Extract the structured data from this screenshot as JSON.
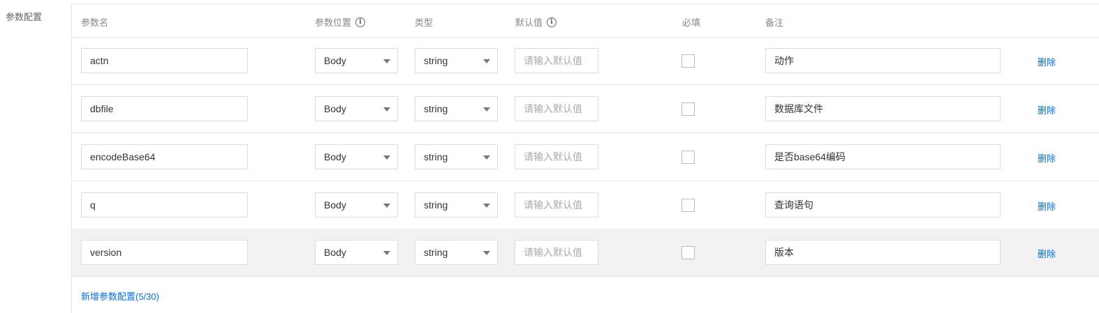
{
  "section_label": "参数配置",
  "headers": {
    "name": "参数名",
    "position": "参数位置",
    "type": "类型",
    "default": "默认值",
    "required": "必填",
    "remark": "备注"
  },
  "rows": [
    {
      "name": "actn",
      "position": "Body",
      "type": "string",
      "default_placeholder": "请输入默认值",
      "required": false,
      "remark": "动作",
      "delete_label": "删除"
    },
    {
      "name": "dbfile",
      "position": "Body",
      "type": "string",
      "default_placeholder": "请输入默认值",
      "required": false,
      "remark": "数据库文件",
      "delete_label": "删除"
    },
    {
      "name": "encodeBase64",
      "position": "Body",
      "type": "string",
      "default_placeholder": "请输入默认值",
      "required": false,
      "remark": "是否base64编码",
      "delete_label": "删除"
    },
    {
      "name": "q",
      "position": "Body",
      "type": "string",
      "default_placeholder": "请输入默认值",
      "required": false,
      "remark": "查询语句",
      "delete_label": "删除"
    },
    {
      "name": "version",
      "position": "Body",
      "type": "string",
      "default_placeholder": "请输入默认值",
      "required": false,
      "remark": "版本",
      "delete_label": "删除"
    }
  ],
  "add_link": "新增参数配置(5/30)",
  "colors": {
    "link": "#006eff",
    "highlight_row": "#f2f2f2",
    "border": "#e5e5e5"
  }
}
